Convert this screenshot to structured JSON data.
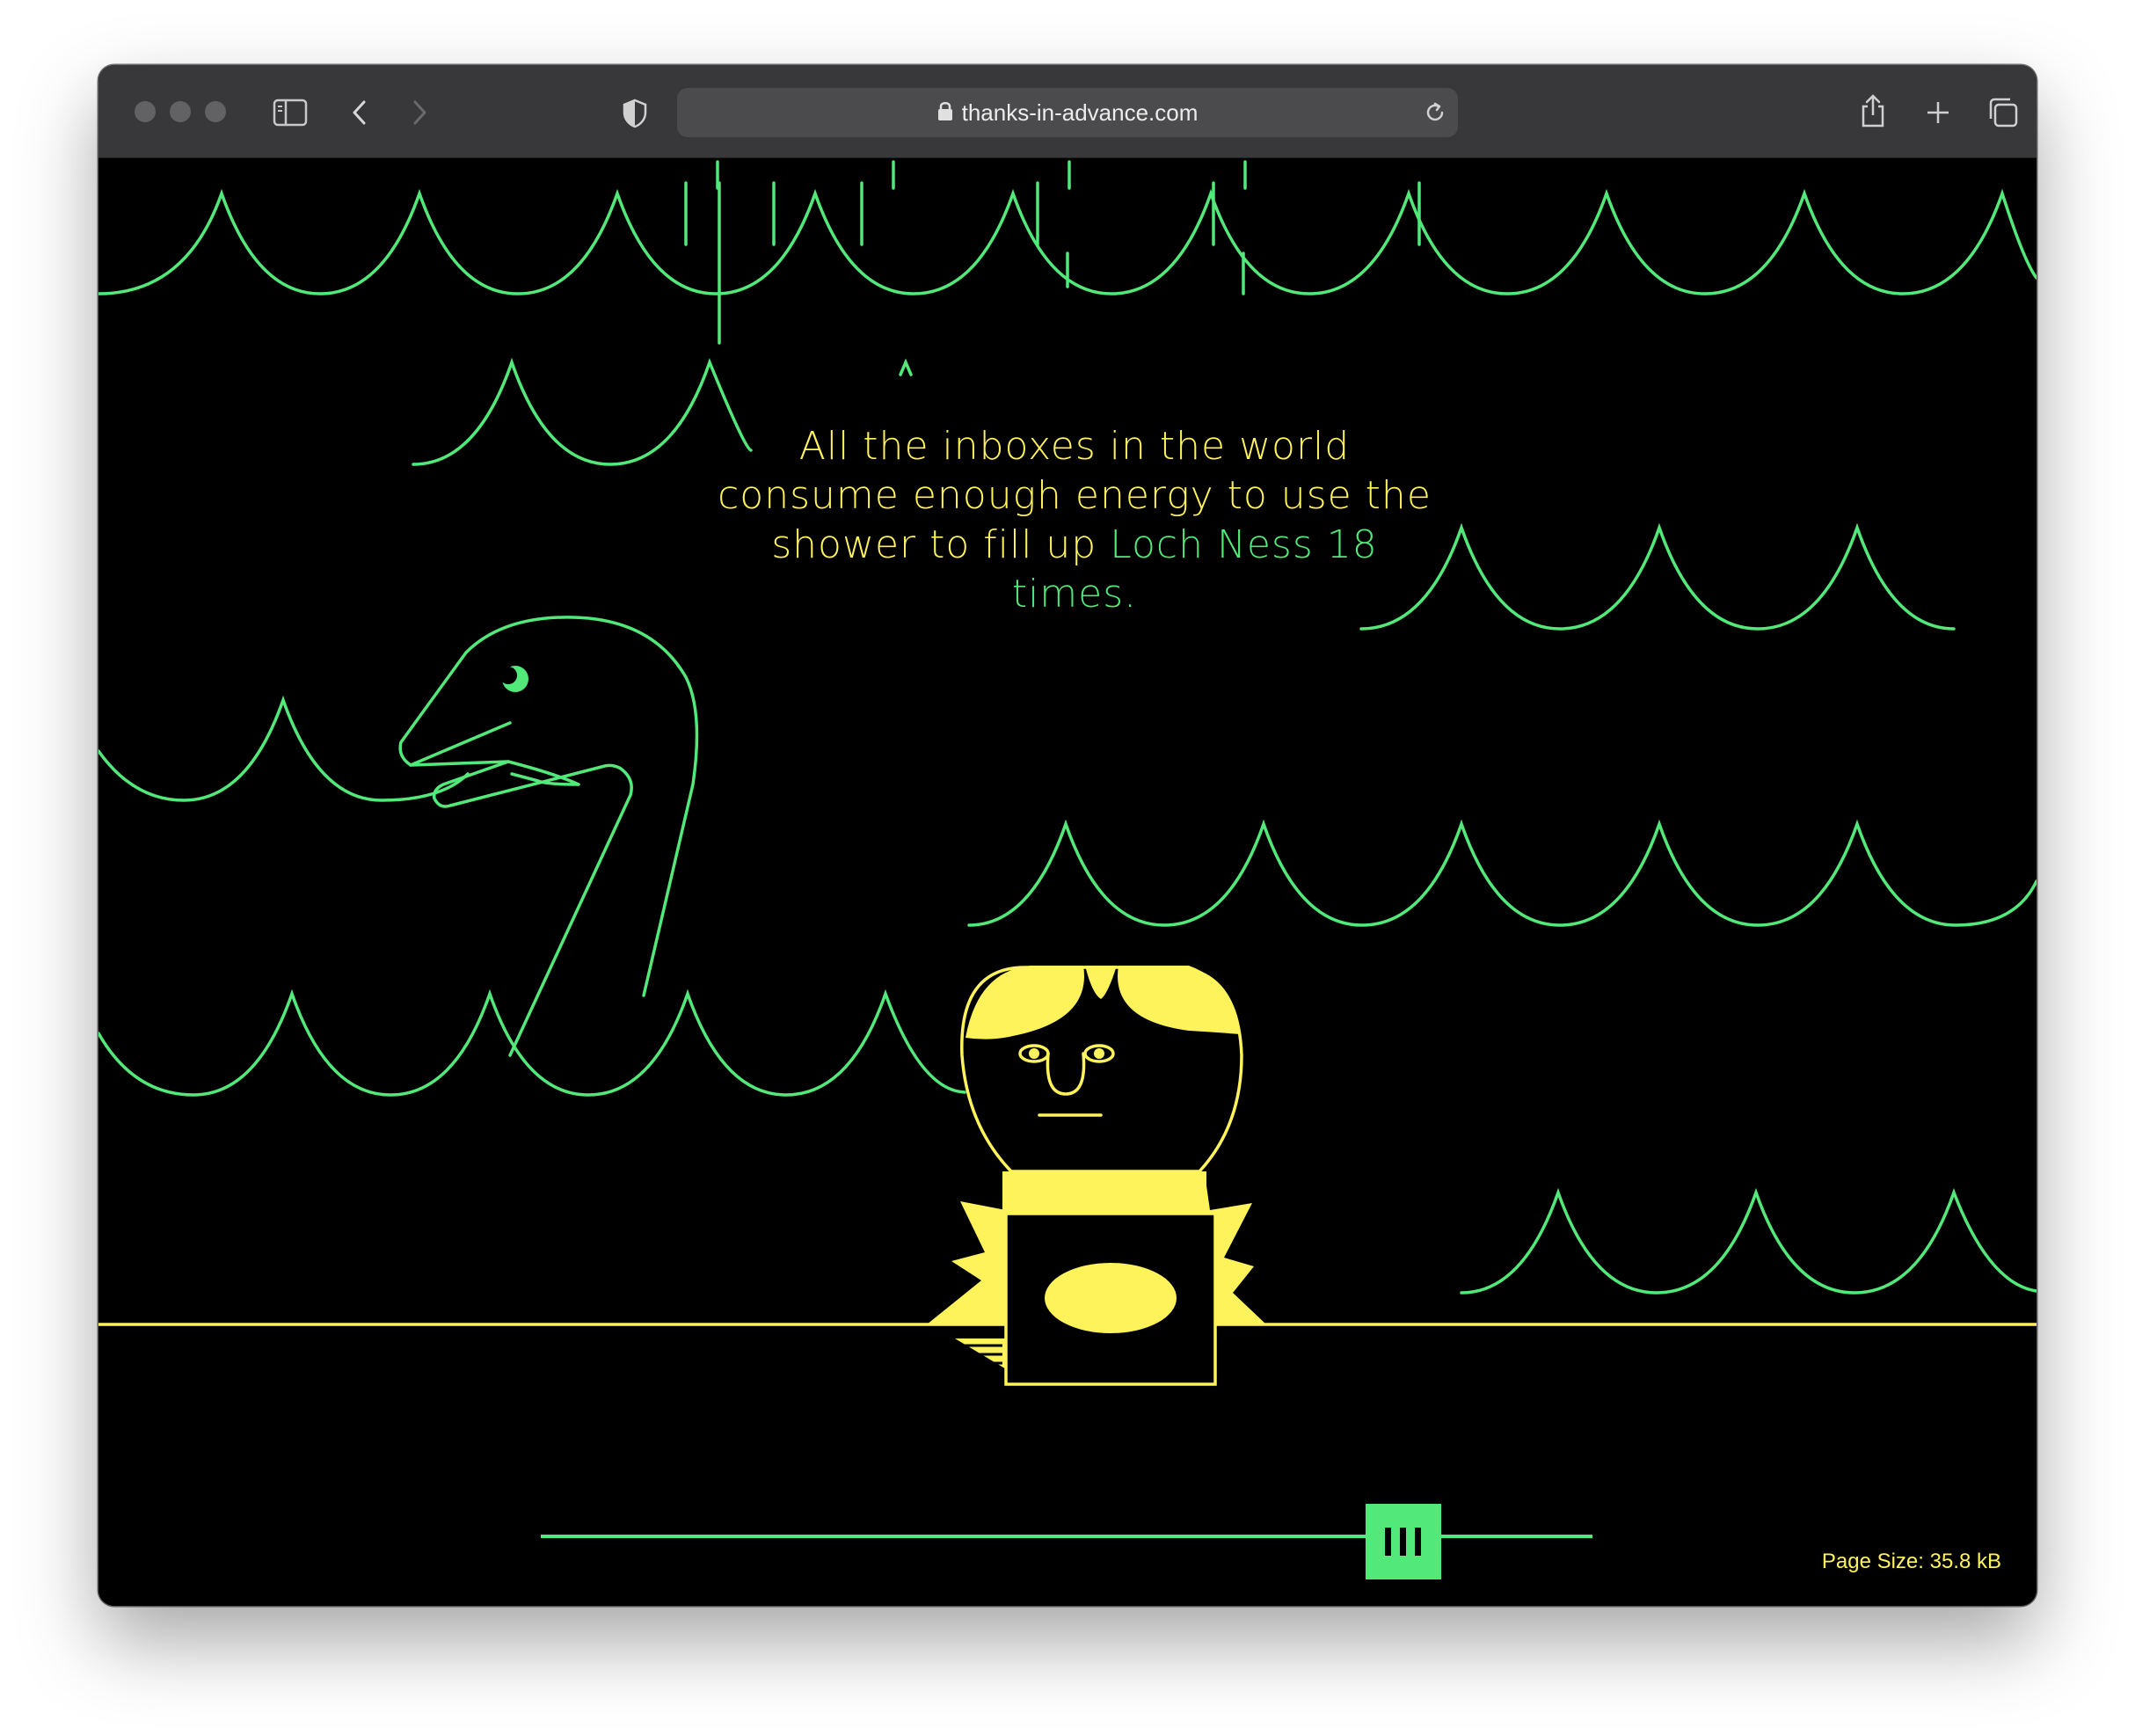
{
  "browser": {
    "url": "thanks-in-advance.com",
    "icons": {
      "sidebar": "sidebar-icon",
      "back": "chevron-left-icon",
      "forward": "chevron-right-icon",
      "privacy": "shield-icon",
      "lock": "lock-icon",
      "reload": "reload-icon",
      "share": "share-icon",
      "new_tab": "plus-icon",
      "tabs": "tabs-overview-icon"
    }
  },
  "caption": {
    "text_before": "All the inboxes in the world consume enough energy to use the shower to fill up ",
    "highlight": "Loch Ness 18 times",
    "text_after": "."
  },
  "slider": {
    "position": 0.82
  },
  "footer": {
    "page_size": "Page Size: 35.8 kB"
  },
  "colors": {
    "background": "#000000",
    "green": "#52e87a",
    "yellow": "#fff35c",
    "toolbar": "#38383a"
  }
}
